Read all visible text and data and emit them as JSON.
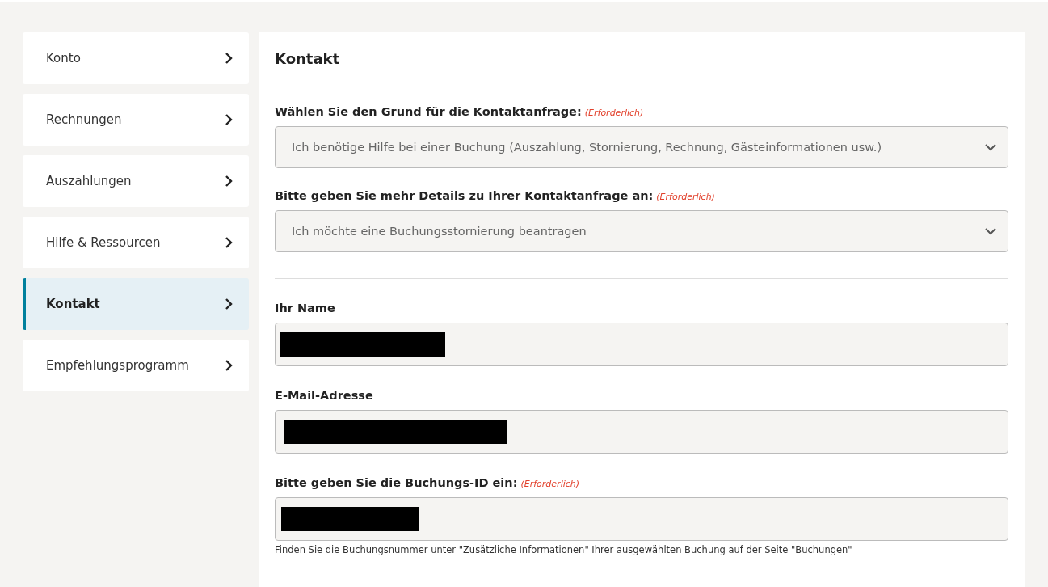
{
  "sidebar": {
    "items": [
      {
        "label": "Konto",
        "selected": false
      },
      {
        "label": "Rechnungen",
        "selected": false
      },
      {
        "label": "Auszahlungen",
        "selected": false
      },
      {
        "label": "Hilfe & Ressourcen",
        "selected": false
      },
      {
        "label": "Kontakt",
        "selected": true
      },
      {
        "label": "Empfehlungsprogramm",
        "selected": false
      }
    ]
  },
  "form": {
    "title": "Kontakt",
    "sections": [
      {
        "fields": [
          {
            "kind": "select",
            "label": "Wählen Sie den Grund für die Kontaktanfrage:",
            "required_note": "(Erforderlich)",
            "value": "Ich benötige Hilfe bei einer Buchung (Auszahlung, Stornierung, Rechnung, Gästeinformationen usw.)"
          },
          {
            "kind": "select",
            "label": "Bitte geben Sie mehr Details zu Ihrer Kontaktanfrage an:",
            "required_note": "(Erforderlich)",
            "value": "Ich möchte eine Buchungsstornierung beantragen"
          }
        ]
      },
      {
        "fields": [
          {
            "kind": "redacted",
            "label": "Ihr Name"
          },
          {
            "kind": "redacted",
            "label": "E-Mail-Adresse"
          },
          {
            "kind": "redacted",
            "label": "Bitte geben Sie die Buchungs-ID ein:",
            "required_note": "(Erforderlich)",
            "hint": "Finden Sie die Buchungsnummer unter \"Zusätzliche Informationen\" Ihrer ausgewählten Buchung auf der Seite \"Buchungen\""
          }
        ]
      }
    ]
  }
}
